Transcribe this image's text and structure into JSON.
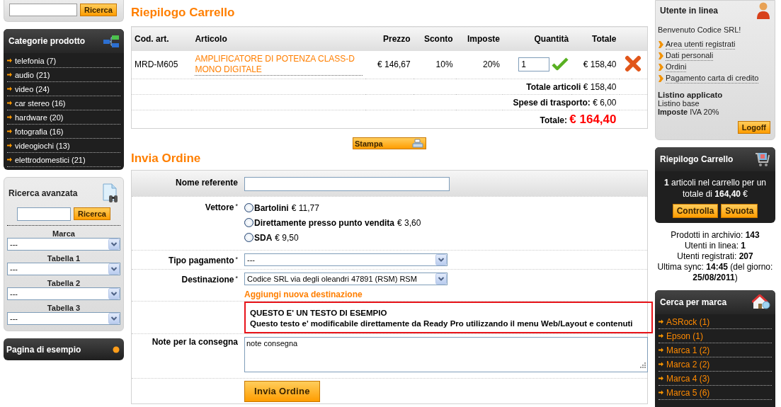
{
  "quick_search": {
    "button": "Ricerca"
  },
  "categories": {
    "title": "Categorie prodotto",
    "items": [
      "telefonia (7)",
      "audio (21)",
      "video (24)",
      "car stereo (16)",
      "hardware (20)",
      "fotografia (16)",
      "videogiochi (13)",
      "elettrodomestici (21)"
    ]
  },
  "advanced_search": {
    "title": "Ricerca avanzata",
    "button": "Ricerca",
    "filters": [
      {
        "label": "Marca",
        "value": "---"
      },
      {
        "label": "Tabella 1",
        "value": "---"
      },
      {
        "label": "Tabella 2",
        "value": "---"
      },
      {
        "label": "Tabella 3",
        "value": "---"
      }
    ]
  },
  "sample_page": {
    "title": "Pagina di esempio"
  },
  "cart": {
    "title": "Riepilogo Carrello",
    "columns": [
      "Cod. art.",
      "Articolo",
      "Prezzo",
      "Sconto",
      "Imposte",
      "Quantità",
      "Totale"
    ],
    "rows": [
      {
        "code": "MRD-M605",
        "article": "AMPLIFICATORE DI POTENZA CLASS-D MONO DIGITALE",
        "price": "€ 146,67",
        "discount": "10%",
        "tax": "20%",
        "quantity": "1",
        "total": "€ 158,40"
      }
    ],
    "summary": [
      {
        "label": "Totale articoli",
        "value": "€ 158,40"
      },
      {
        "label": "Spese di trasporto:",
        "value": "€ 6,00"
      }
    ],
    "grand_total": {
      "label": "Totale:",
      "value": "€ 164,40"
    },
    "print_button": "Stampa"
  },
  "order": {
    "title": "Invia Ordine",
    "contact": {
      "label": "Nome referente"
    },
    "carrier": {
      "label": "Vettore",
      "mark": "*",
      "options": [
        {
          "name": "Bartolini",
          "price": "€ 11,77",
          "selected": false
        },
        {
          "name": "Direttamente presso punto vendita",
          "price": "€ 3,60",
          "selected": false
        },
        {
          "name": "SDA",
          "price": "€ 9,50",
          "selected": false
        }
      ]
    },
    "payment": {
      "label": "Tipo pagamento",
      "mark": "*",
      "value": "---"
    },
    "destination": {
      "label": "Destinazione",
      "mark": "*",
      "value": "Codice SRL via degli oleandri 47891 (RSM) RSM",
      "link": "Aggiungi nuova destinazione"
    },
    "notice": {
      "title": "QUESTO E' UN TESTO DI ESEMPIO",
      "text": "Questo testo e' modificabile direttamente da Ready Pro utilizzando il menu Web/Layout e contenuti"
    },
    "notes": {
      "label": "Note per la consegna",
      "value": "note consegna"
    },
    "submit": "Invia Ordine"
  },
  "user": {
    "title": "Utente in linea",
    "welcome": "Benvenuto Codice SRL!",
    "links": [
      "Area utenti registrati",
      "Dati personali",
      "Ordini",
      "Pagamento carta di credito"
    ],
    "price_list_label": "Listino applicato",
    "price_list": "Listino base",
    "tax_line": "**Imposte** IVA 20%",
    "button": "Logoff"
  },
  "mini_cart": {
    "title": "Riepilogo Carrello",
    "text": "**1** articoli nel carrello per un totale di **164,40** €",
    "buttons": [
      "Controlla",
      "Svuota"
    ]
  },
  "stats": [
    "Prodotti in archivio: **143**",
    "Utenti in linea: **1**",
    "Utenti registrati: **207**",
    "Ultima sync: **14:45** (del giorno: **25/08/2011**)"
  ],
  "brands": {
    "title": "Cerca per marca",
    "items": [
      "ASRock (1)",
      "Epson (1)",
      "Marca 1 (2)",
      "Marca 2 (2)",
      "Marca 4 (3)",
      "Marca 5 (6)"
    ]
  }
}
